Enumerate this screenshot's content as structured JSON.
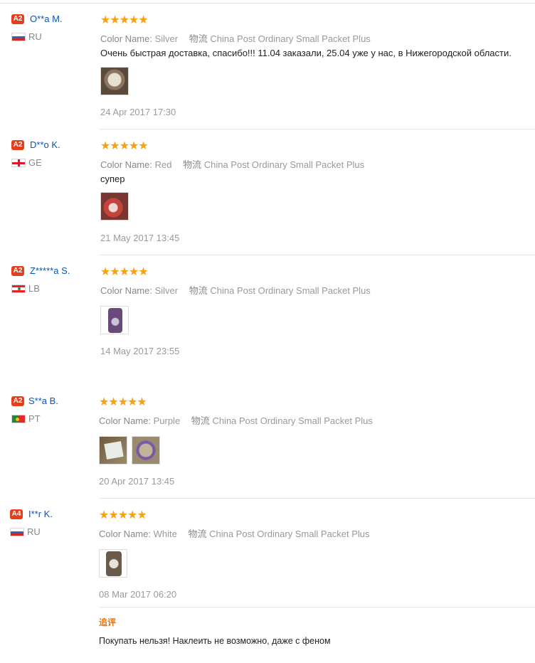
{
  "labels": {
    "color_name": "Color Name:",
    "shipping": "物流",
    "append": "追评"
  },
  "stars": "★★★★★",
  "reviews": [
    {
      "badge": "A2",
      "name": "O**a M.",
      "country": "RU",
      "color": "Silver",
      "shipping": "China Post Ordinary Small Packet Plus",
      "text": "Очень быстрая доставка, спасибо!!! 11.04 заказали, 25.04 уже у нас, в Нижегородской области.",
      "date": "24 Apr 2017 17:30"
    },
    {
      "badge": "A2",
      "name": "D**o K.",
      "country": "GE",
      "color": "Red",
      "shipping": "China Post Ordinary Small Packet Plus",
      "text": "супер",
      "date": "21 May 2017 13:45"
    },
    {
      "badge": "A2",
      "name": "Z*****a S.",
      "country": "LB",
      "color": "Silver",
      "shipping": "China Post Ordinary Small Packet Plus",
      "text": "",
      "date": "14 May 2017 23:55"
    },
    {
      "badge": "A2",
      "name": "S**a B.",
      "country": "PT",
      "color": "Purple",
      "shipping": "China Post Ordinary Small Packet Plus",
      "text": "",
      "date": "20 Apr 2017 13:45"
    },
    {
      "badge": "A4",
      "name": "I**r K.",
      "country": "RU",
      "color": "White",
      "shipping": "China Post Ordinary Small Packet Plus",
      "text": "",
      "date": "08 Mar 2017 06:20",
      "append_text": "Покупать нельзя! Наклеить не возможно, даже с феном"
    }
  ]
}
